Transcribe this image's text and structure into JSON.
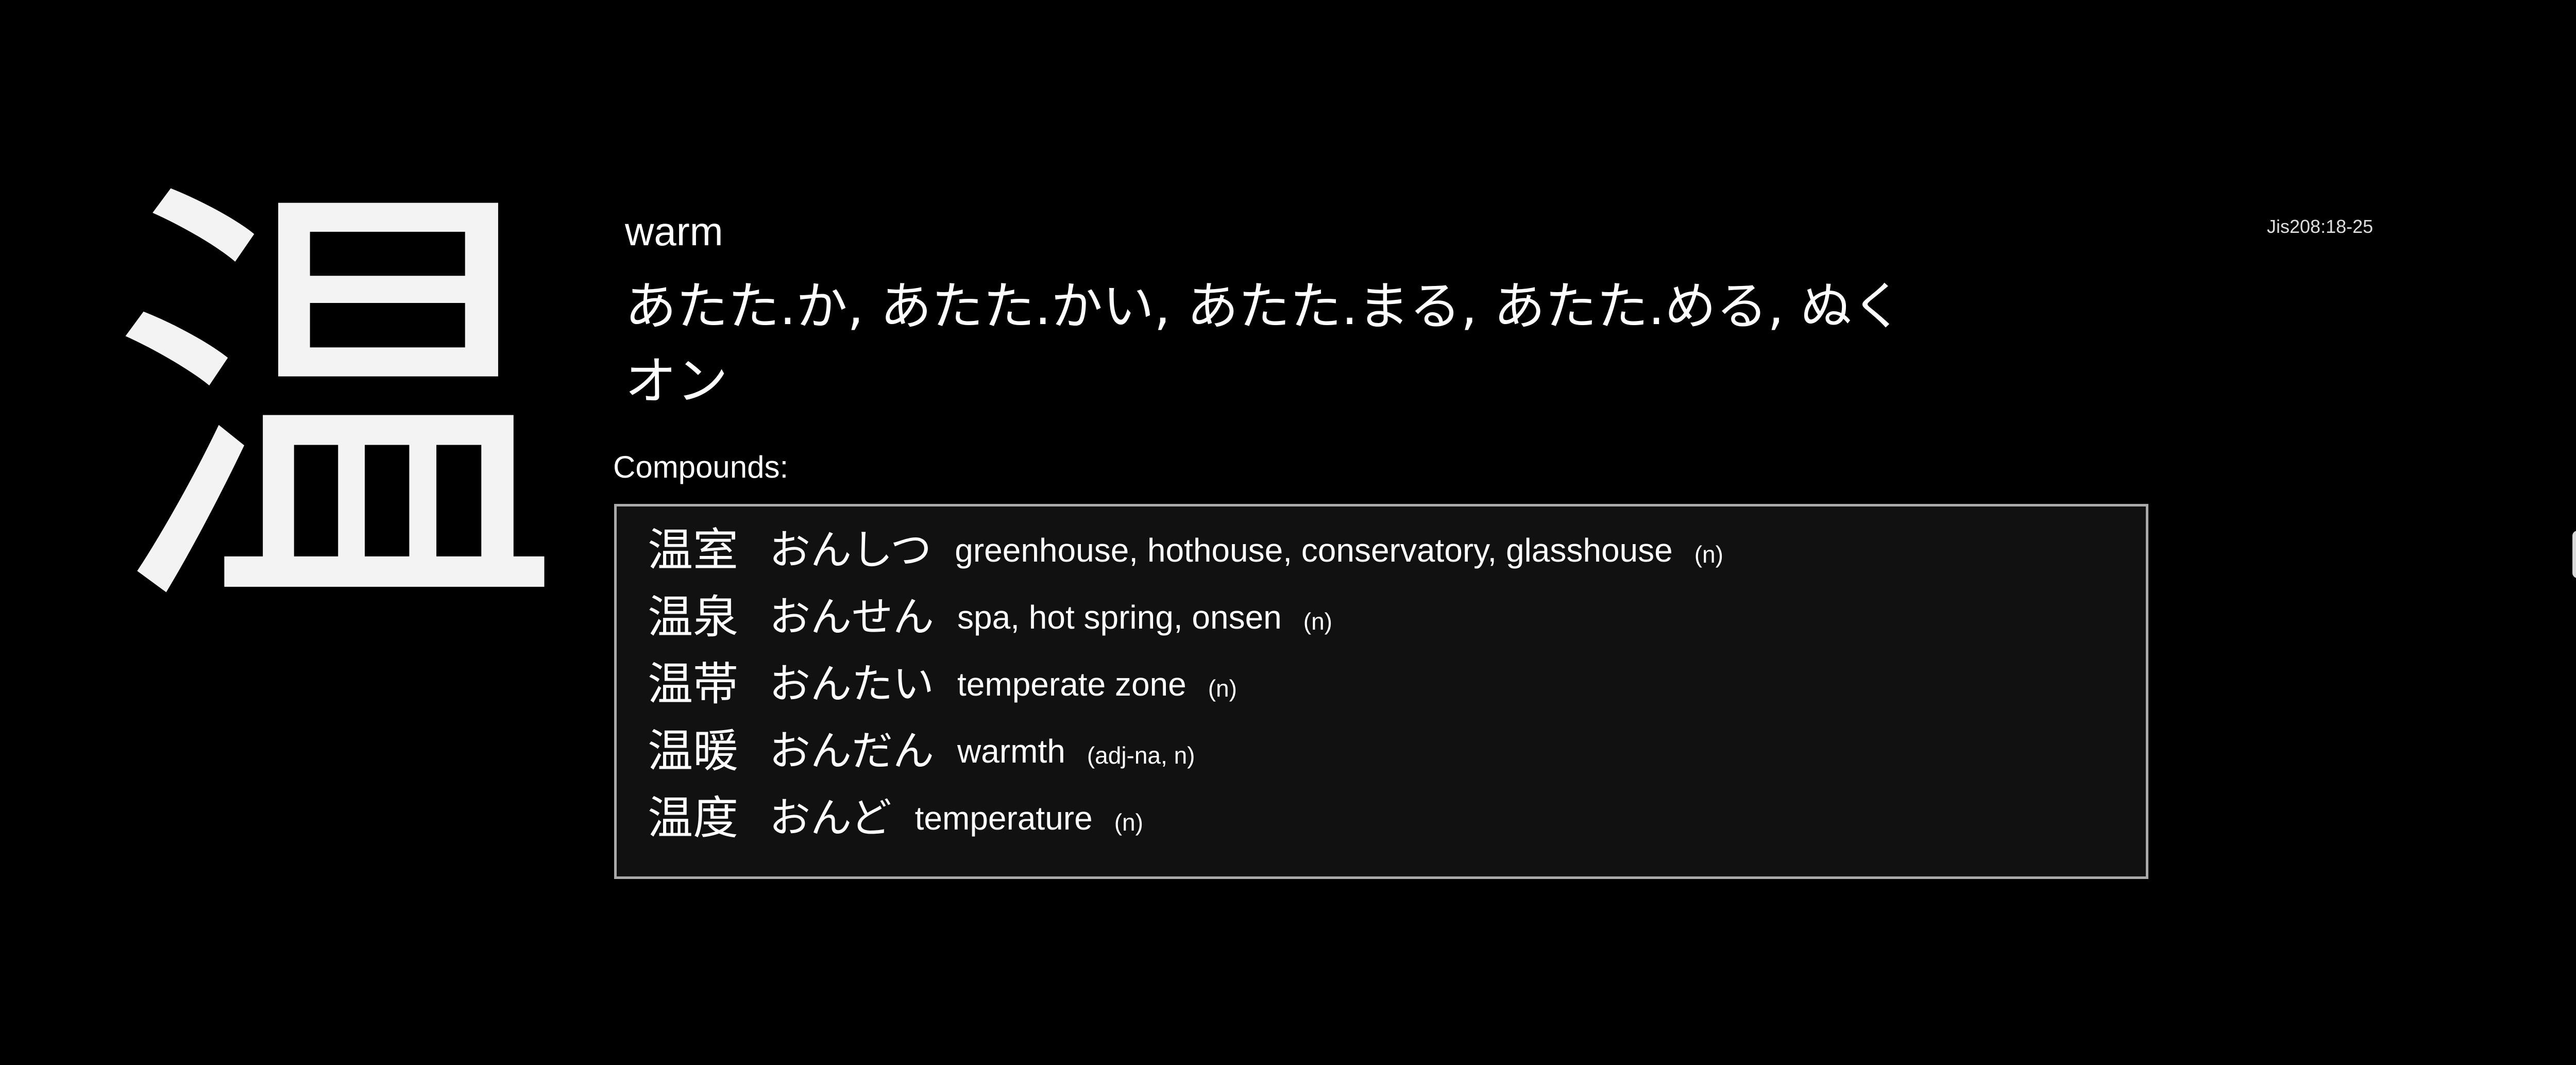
{
  "kanji": "温",
  "meaning": "warm",
  "kun_readings": "あたた.か, あたた.かい, あたた.まる, あたた.める, ぬく",
  "on_readings": "オン",
  "reference": "Jis208:18-25",
  "compounds_label": "Compounds:",
  "compounds": [
    {
      "word": "温室",
      "reading": "おんしつ",
      "gloss": "greenhouse, hothouse, conservatory, glasshouse",
      "pos": "(n)"
    },
    {
      "word": "温泉",
      "reading": "おんせん",
      "gloss": "spa, hot spring, onsen",
      "pos": "(n)"
    },
    {
      "word": "温帯",
      "reading": "おんたい",
      "gloss": "temperate zone",
      "pos": "(n)"
    },
    {
      "word": "温暖",
      "reading": "おんだん",
      "gloss": "warmth",
      "pos": "(adj-na, n)"
    },
    {
      "word": "温度",
      "reading": "おんど",
      "gloss": "temperature",
      "pos": "(n)"
    }
  ],
  "colors": {
    "background": "#000000",
    "text": "#ffffff",
    "box_background": "#111111",
    "box_border": "#aaaaaa"
  }
}
